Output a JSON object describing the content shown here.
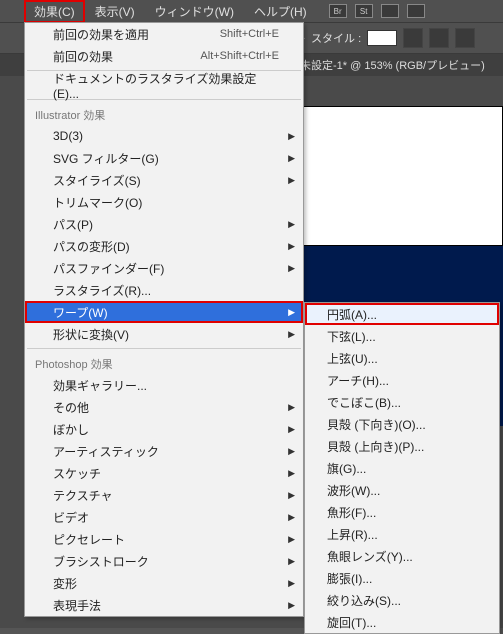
{
  "menubar": {
    "items": [
      "効果(C)",
      "表示(V)",
      "ウィンドウ(W)",
      "ヘルプ(H)"
    ],
    "selected_index": 0,
    "icons": [
      "Br",
      "St"
    ]
  },
  "toolbar": {
    "style_label": "スタイル :",
    "swatch_color": "#ffffff"
  },
  "tab": {
    "title": "未設定-1* @ 153% (RGB/プレビュー)"
  },
  "menu1": {
    "top": [
      {
        "label": "前回の効果を適用",
        "shortcut": "Shift+Ctrl+E"
      },
      {
        "label": "前回の効果",
        "shortcut": "Alt+Shift+Ctrl+E"
      }
    ],
    "raster_settings": "ドキュメントのラスタライズ効果設定(E)...",
    "section1": "Illustrator 効果",
    "illustrator": [
      {
        "label": "3D(3)",
        "submenu": true
      },
      {
        "label": "SVG フィルター(G)",
        "submenu": true
      },
      {
        "label": "スタイライズ(S)",
        "submenu": true
      },
      {
        "label": "トリムマーク(O)"
      },
      {
        "label": "パス(P)",
        "submenu": true
      },
      {
        "label": "パスの変形(D)",
        "submenu": true
      },
      {
        "label": "パスファインダー(F)",
        "submenu": true
      },
      {
        "label": "ラスタライズ(R)..."
      },
      {
        "label": "ワープ(W)",
        "submenu": true,
        "selected": true,
        "highlighted": true
      },
      {
        "label": "形状に変換(V)",
        "submenu": true
      }
    ],
    "section2": "Photoshop 効果",
    "photoshop": [
      {
        "label": "効果ギャラリー..."
      },
      {
        "label": "その他",
        "submenu": true
      },
      {
        "label": "ぼかし",
        "submenu": true
      },
      {
        "label": "アーティスティック",
        "submenu": true
      },
      {
        "label": "スケッチ",
        "submenu": true
      },
      {
        "label": "テクスチャ",
        "submenu": true
      },
      {
        "label": "ビデオ",
        "submenu": true
      },
      {
        "label": "ピクセレート",
        "submenu": true
      },
      {
        "label": "ブラシストローク",
        "submenu": true
      },
      {
        "label": "変形",
        "submenu": true
      },
      {
        "label": "表現手法",
        "submenu": true
      }
    ]
  },
  "menu2": {
    "items": [
      {
        "label": "円弧(A)...",
        "highlighted": true
      },
      {
        "label": "下弦(L)..."
      },
      {
        "label": "上弦(U)..."
      },
      {
        "label": "アーチ(H)..."
      },
      {
        "label": "でこぼこ(B)..."
      },
      {
        "label": "貝殻 (下向き)(O)..."
      },
      {
        "label": "貝殻 (上向き)(P)..."
      },
      {
        "label": "旗(G)..."
      },
      {
        "label": "波形(W)..."
      },
      {
        "label": "魚形(F)..."
      },
      {
        "label": "上昇(R)..."
      },
      {
        "label": "魚眼レンズ(Y)..."
      },
      {
        "label": "膨張(I)..."
      },
      {
        "label": "絞り込み(S)..."
      },
      {
        "label": "旋回(T)..."
      }
    ]
  }
}
